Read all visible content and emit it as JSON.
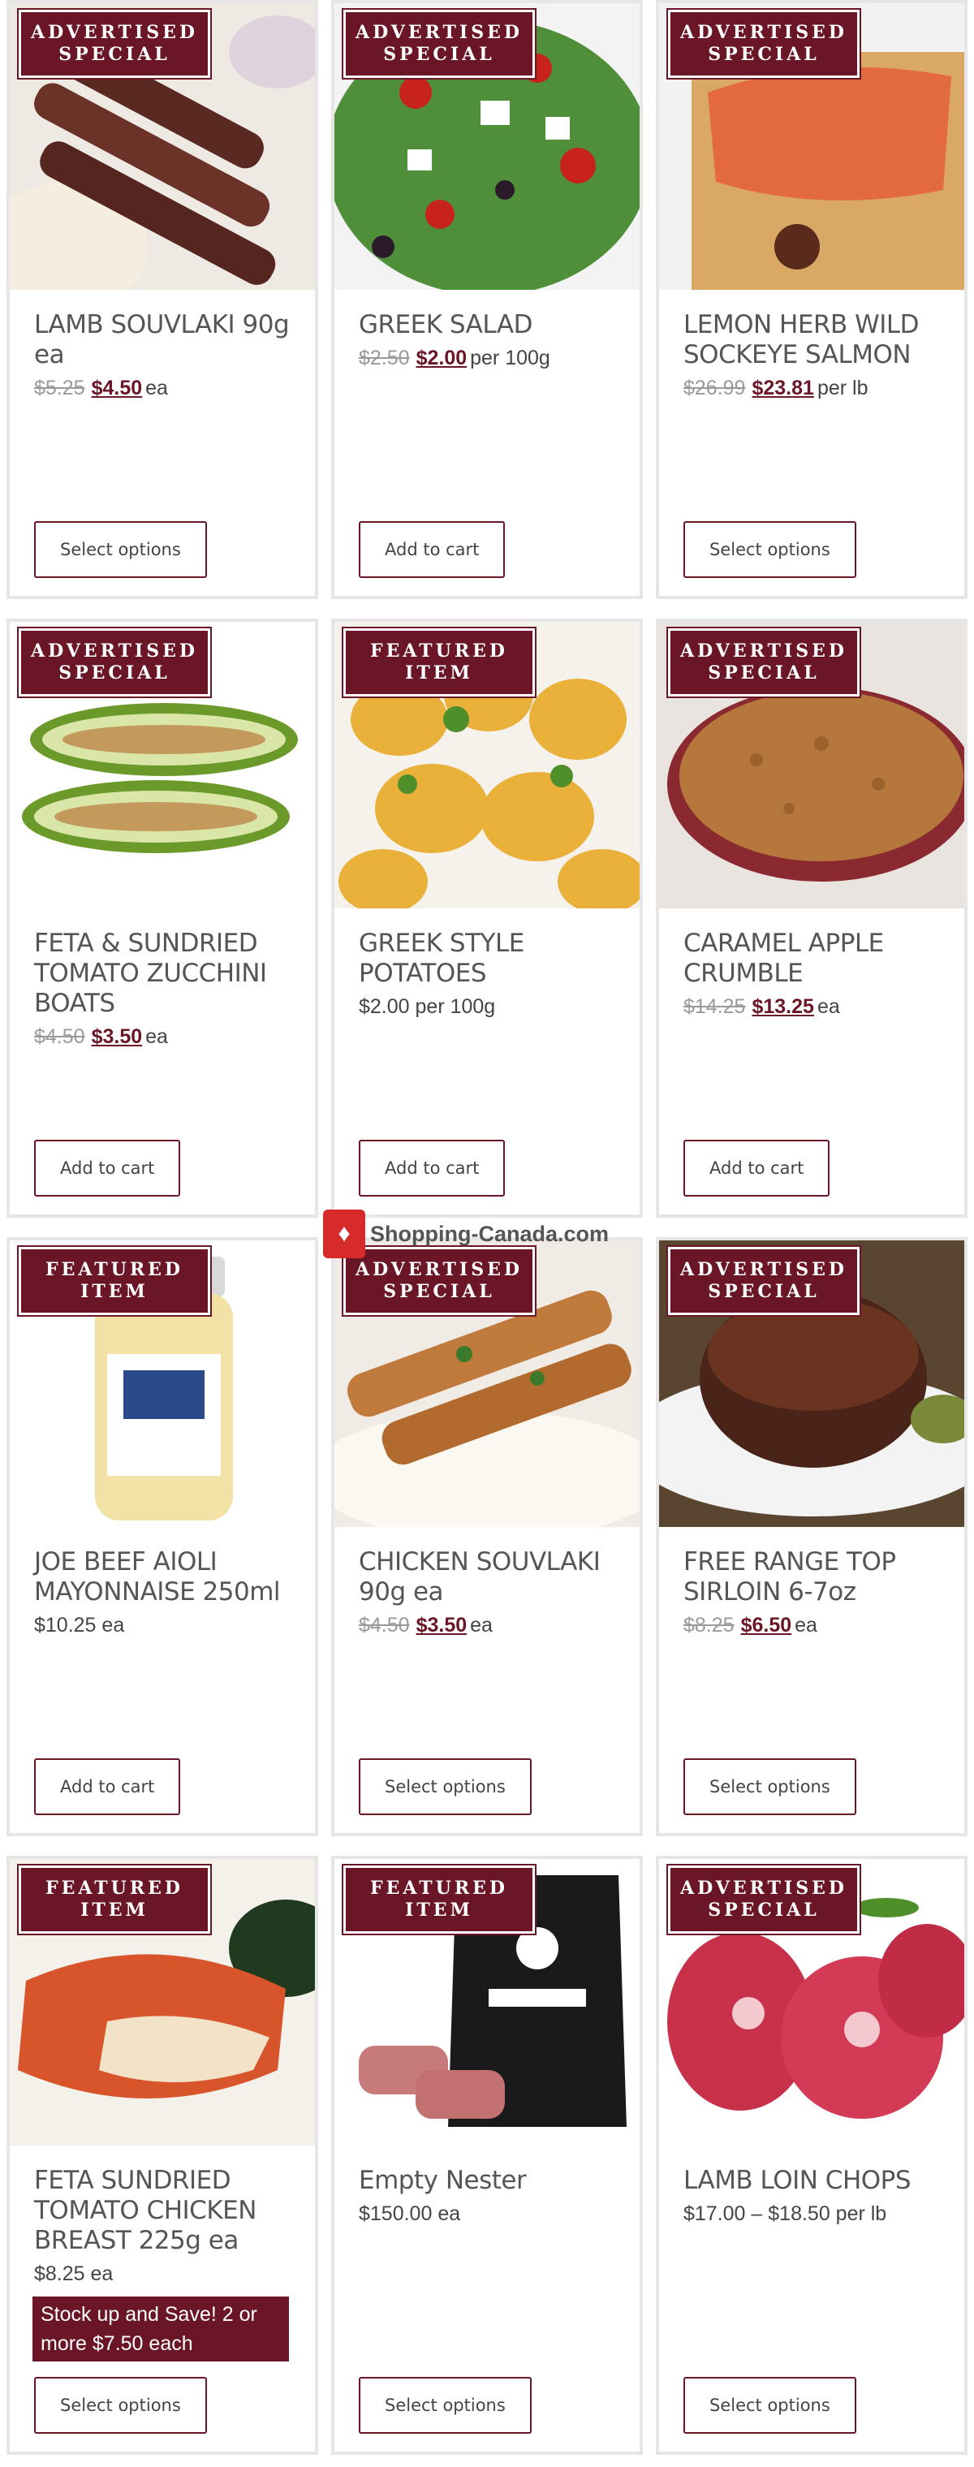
{
  "products": [
    {
      "badge_line1": "ADVERTISED",
      "badge_line2": "SPECIAL",
      "title": "LAMB SOUVLAKI 90g ea",
      "old_price": "$5.25",
      "price": "$4.50",
      "unit": "ea",
      "promo": "",
      "button": "Select options"
    },
    {
      "badge_line1": "ADVERTISED",
      "badge_line2": "SPECIAL",
      "title": "GREEK SALAD",
      "old_price": "$2.50",
      "price": "$2.00",
      "unit": "per 100g",
      "promo": "",
      "button": "Add to cart"
    },
    {
      "badge_line1": "ADVERTISED",
      "badge_line2": "SPECIAL",
      "title": "LEMON HERB WILD SOCKEYE SALMON",
      "old_price": "$26.99",
      "price": "$23.81",
      "unit": "per lb",
      "promo": "",
      "button": "Select options"
    },
    {
      "badge_line1": "ADVERTISED",
      "badge_line2": "SPECIAL",
      "title": "FETA & SUNDRIED TOMATO ZUCCHINI BOATS",
      "old_price": "$4.50",
      "price": "$3.50",
      "unit": "ea",
      "promo": "",
      "button": "Add to cart"
    },
    {
      "badge_line1": "FEATURED",
      "badge_line2": "ITEM",
      "title": "GREEK STYLE POTATOES",
      "old_price": "",
      "price": "",
      "unit": "$2.00 per 100g",
      "promo": "",
      "button": "Add to cart"
    },
    {
      "badge_line1": "ADVERTISED",
      "badge_line2": "SPECIAL",
      "title": "CARAMEL APPLE CRUMBLE",
      "old_price": "$14.25",
      "price": "$13.25",
      "unit": "ea",
      "promo": "",
      "button": "Add to cart"
    },
    {
      "badge_line1": "FEATURED",
      "badge_line2": "ITEM",
      "title": "JOE BEEF AIOLI MAYONNAISE 250ml",
      "old_price": "",
      "price": "",
      "unit": "$10.25 ea",
      "promo": "",
      "button": "Add to cart"
    },
    {
      "badge_line1": "ADVERTISED",
      "badge_line2": "SPECIAL",
      "title": "CHICKEN SOUVLAKI 90g ea",
      "old_price": "$4.50",
      "price": "$3.50",
      "unit": "ea",
      "promo": "",
      "button": "Select options"
    },
    {
      "badge_line1": "ADVERTISED",
      "badge_line2": "SPECIAL",
      "title": "FREE RANGE TOP SIRLOIN 6-7oz",
      "old_price": "$8.25",
      "price": "$6.50",
      "unit": "ea",
      "promo": "",
      "button": "Select options"
    },
    {
      "badge_line1": "FEATURED",
      "badge_line2": "ITEM",
      "title": "FETA SUNDRIED TOMATO CHICKEN BREAST 225g ea",
      "old_price": "",
      "price": "",
      "unit": "$8.25 ea",
      "promo": "Stock up and Save! 2 or more $7.50 each",
      "button": "Select options"
    },
    {
      "badge_line1": "FEATURED",
      "badge_line2": "ITEM",
      "title": "Empty Nester",
      "old_price": "",
      "price": "",
      "unit": "$150.00 ea",
      "promo": "",
      "button": "Select options"
    },
    {
      "badge_line1": "ADVERTISED",
      "badge_line2": "SPECIAL",
      "title": "LAMB LOIN CHOPS",
      "old_price": "",
      "price": "",
      "unit": "$17.00 – $18.50 per lb",
      "promo": "",
      "button": "Select options"
    }
  ],
  "watermark": {
    "text": "Shopping-Canada.com",
    "icon": "shopping-bag-maple-icon"
  },
  "colors": {
    "accent": "#6b1626",
    "border": "#e6e6e6"
  },
  "image_icons": [
    "lamb-souvlaki-image",
    "greek-salad-image",
    "salmon-image",
    "zucchini-boats-image",
    "potatoes-image",
    "apple-crumble-image",
    "aioli-jar-image",
    "chicken-souvlaki-image",
    "sirloin-image",
    "chicken-breast-image",
    "tbones-bag-image",
    "lamb-chops-image"
  ]
}
